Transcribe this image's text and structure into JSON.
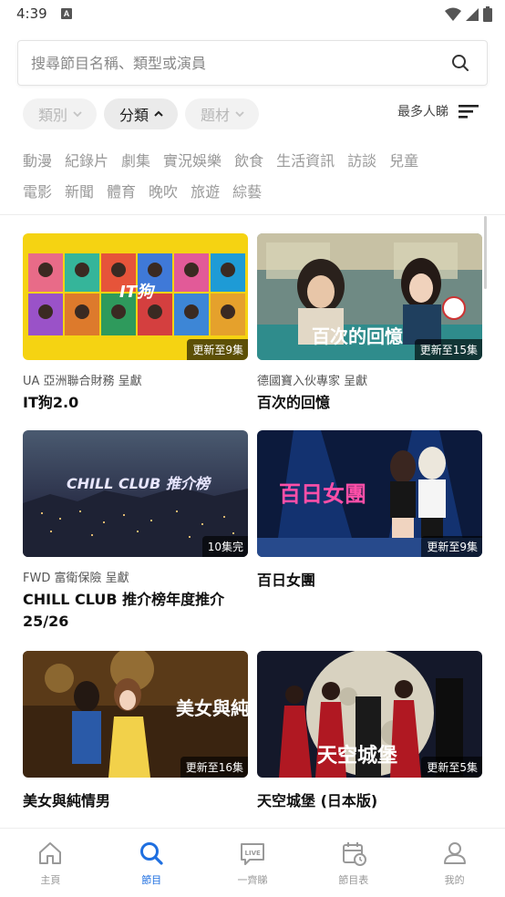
{
  "status_bar": {
    "time": "4:39",
    "notification_letter": "A"
  },
  "search": {
    "placeholder": "搜尋節目名稱、類型或演員"
  },
  "filters": {
    "chips": [
      {
        "label": "類別",
        "active": false
      },
      {
        "label": "分類",
        "active": true
      },
      {
        "label": "題材",
        "active": false
      }
    ],
    "sort_label": "最多人睇"
  },
  "categories": {
    "row1": [
      "動漫",
      "紀錄片",
      "劇集",
      "實況娛樂",
      "飲食",
      "生活資訊",
      "訪談",
      "兒童"
    ],
    "row2": [
      "電影",
      "新聞",
      "體育",
      "晚吹",
      "旅遊",
      "綜藝"
    ]
  },
  "programs": [
    {
      "sponsor": "UA 亞洲聯合財務 呈獻",
      "title": "IT狗2.0",
      "badge": "更新至9集",
      "thumb_text": "IT狗"
    },
    {
      "sponsor": "德國寶入伙專家 呈獻",
      "title": "百次的回憶",
      "badge": "更新至15集",
      "thumb_text": "百次的回憶"
    },
    {
      "sponsor": "FWD 富衛保險 呈獻",
      "title": "CHILL CLUB 推介榜年度推介 25/26",
      "badge": "10集完",
      "thumb_text": "CHILL CLUB 推介榜"
    },
    {
      "sponsor": "",
      "title": "百日女團",
      "badge": "更新至9集",
      "thumb_text": "百日女團"
    },
    {
      "sponsor": "",
      "title": "美女與純情男",
      "badge": "更新至16集",
      "thumb_text": "美女與純情男"
    },
    {
      "sponsor": "",
      "title": "天空城堡 (日本版)",
      "badge": "更新至5集",
      "thumb_text": "天空城堡"
    }
  ],
  "bottom_nav": [
    {
      "label": "主頁",
      "icon": "home-icon",
      "active": false
    },
    {
      "label": "節目",
      "icon": "search-icon",
      "active": true
    },
    {
      "label": "一齊睇",
      "icon": "live-icon",
      "active": false
    },
    {
      "label": "節目表",
      "icon": "calendar-icon",
      "active": false
    },
    {
      "label": "我的",
      "icon": "user-icon",
      "active": false
    }
  ],
  "colors": {
    "accent": "#1f6fe0",
    "inactive": "#999999"
  }
}
